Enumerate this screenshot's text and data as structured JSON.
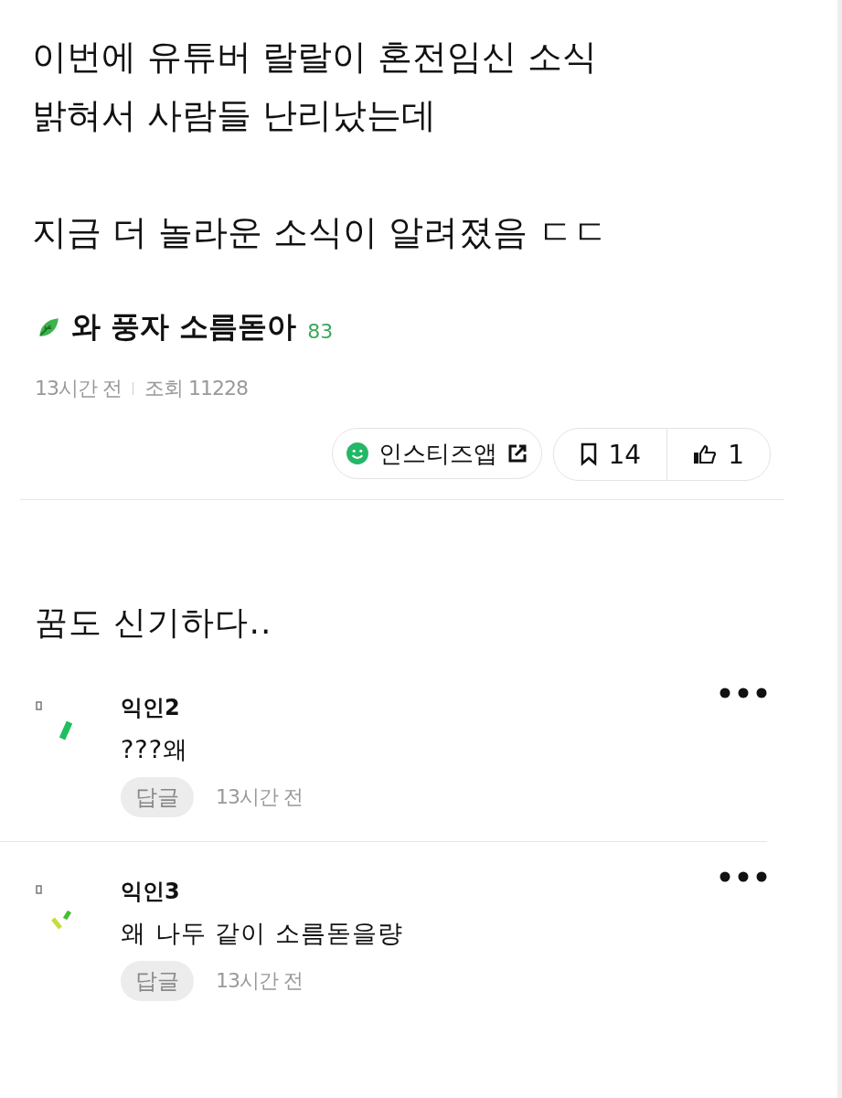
{
  "post": {
    "paragraphs": [
      [
        "이번에 유튜버 랄랄이 혼전임신 소식",
        "밝혀서 사람들 난리났는데"
      ],
      [
        "지금 더 놀라운 소식이 알려졌음 ㄷㄷ"
      ]
    ],
    "author": "와 풍자 소름돋아",
    "author_score": "83",
    "time": "13시간 전",
    "views": "조회 11228",
    "app_button": "인스티즈앱",
    "bookmark_count": "14",
    "like_count": "1"
  },
  "comment_title": "꿈도 신기하다..",
  "comments": [
    {
      "name": "익인2",
      "text": "???왜",
      "reply": "답글",
      "time": "13시간 전",
      "color": "#1fbf5f"
    },
    {
      "name": "익인3",
      "text": "왜 나두 같이 소름돋을량",
      "reply": "답글",
      "time": "13시간 전",
      "color": "#c8dc3c"
    }
  ]
}
